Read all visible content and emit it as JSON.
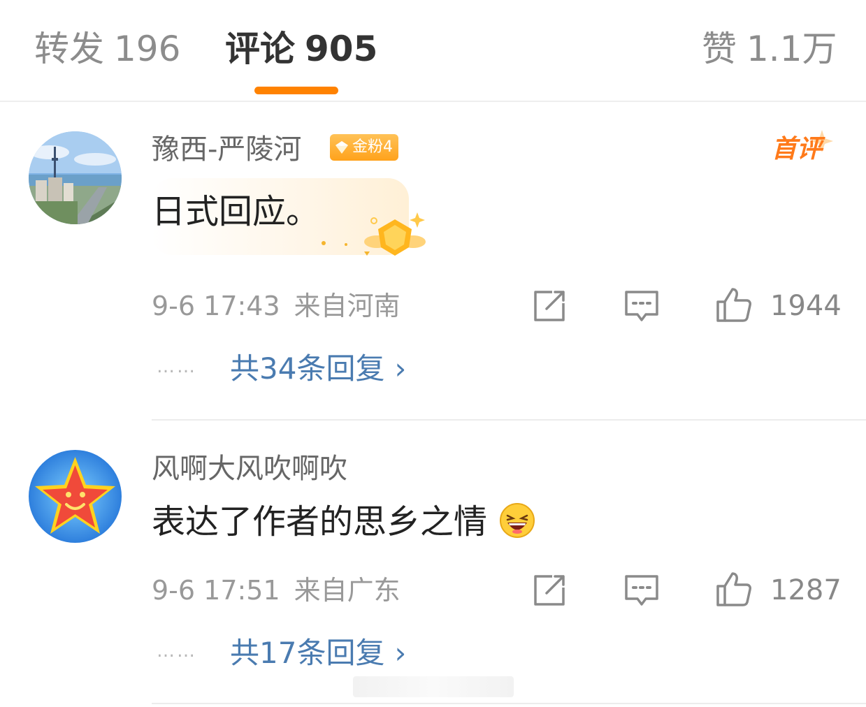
{
  "tabs": {
    "repost_label": "转发",
    "repost_count": "196",
    "comment_label": "评论",
    "comment_count": "905",
    "like_label": "赞",
    "like_count": "1.1万"
  },
  "comments": [
    {
      "username": "豫西-严陵河",
      "badge": "金粉4",
      "first_tag": "首评",
      "text": "日式回应。",
      "time": "9-6 17:43",
      "location": "来自河南",
      "likes": "1944",
      "dots": "……",
      "replies": "共34条回复",
      "chevron": "›"
    },
    {
      "username": "风啊大风吹啊吹",
      "text": "表达了作者的思乡之情",
      "time": "9-6 17:51",
      "location": "来自广东",
      "likes": "1287",
      "dots": "……",
      "replies": "共17条回复",
      "chevron": "›"
    }
  ],
  "colors": {
    "accent": "#ff8200",
    "link": "#4a7bb0",
    "badge": "#ffa21b",
    "first_tag": "#ff7a1a"
  },
  "icons": {
    "repost": "share-out-icon",
    "comment": "comment-bubble-icon",
    "like": "thumbs-up-icon",
    "emoji": "laughing-emoji-icon",
    "badge": "gem-icon"
  }
}
